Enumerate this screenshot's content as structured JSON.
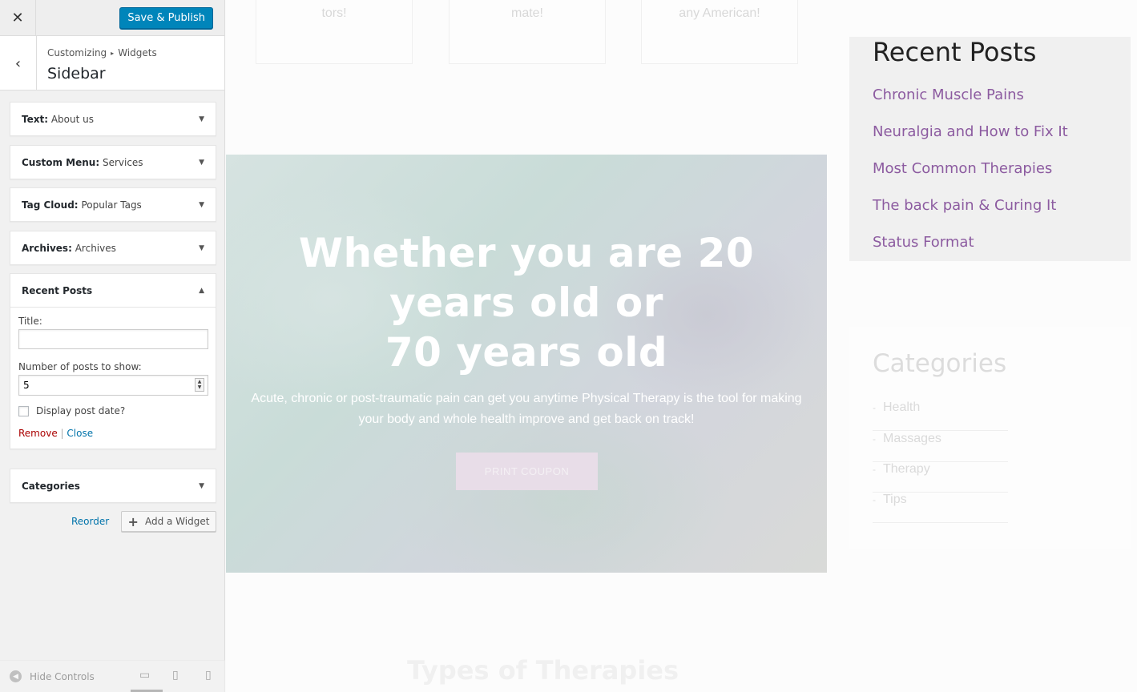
{
  "panel": {
    "close_symbol": "✕",
    "save_label": "Save & Publish",
    "back_symbol": "‹",
    "breadcrumb": {
      "root": "Customizing",
      "separator": "▸",
      "current": "Widgets"
    },
    "section_title": "Sidebar",
    "widgets": [
      {
        "type": "Text:",
        "name": "About us",
        "arrow": "▼"
      },
      {
        "type": "Custom Menu:",
        "name": "Services",
        "arrow": "▼"
      },
      {
        "type": "Tag Cloud:",
        "name": "Popular Tags",
        "arrow": "▼"
      },
      {
        "type": "Archives:",
        "name": "Archives",
        "arrow": "▼"
      },
      {
        "type": "Recent Posts",
        "name": "",
        "arrow": "▲"
      },
      {
        "type": "Categories",
        "name": "",
        "arrow": "▼"
      }
    ],
    "recent_form": {
      "title_label": "Title:",
      "title_value": "",
      "number_label": "Number of posts to show:",
      "number_value": "5",
      "date_label": "Display post date?",
      "date_checked": false,
      "remove_label": "Remove",
      "divider": "|",
      "close_label": "Close"
    },
    "reorder_label": "Reorder",
    "add_widget_label": "Add a Widget",
    "hide_controls_label": "Hide Controls"
  },
  "preview": {
    "top_cards": [
      "tors!",
      "mate!",
      "any American!"
    ],
    "hero": {
      "heading_lines": [
        "Whether you are 20",
        "years old or",
        "70 years old"
      ],
      "subtitle_lines": [
        "Acute, chronic or post-traumatic pain can get you anytime Physical Therapy is the tool for making",
        "your body and whole health improve and get back on track!"
      ],
      "button_label": "PRINT COUPON"
    },
    "recent_posts": {
      "title": "Recent Posts",
      "items": [
        "Chronic Muscle Pains",
        "Neuralgia and How to Fix It",
        "Most Common Therapies",
        "The back pain & Curing It",
        "Status Format"
      ],
      "link_color": "#8c5ba0"
    },
    "categories": {
      "title": "Categories",
      "dash": "-",
      "items": [
        "Health",
        "Massages",
        "Therapy",
        "Tips"
      ]
    },
    "section_title": "Types of Therapies"
  },
  "colors": {
    "primary_button": "#0085ba",
    "link": "#0073aa",
    "remove": "#aa0000"
  },
  "icons": {
    "close": "close-icon",
    "back": "back-chevron-icon",
    "plus": "plus-icon",
    "desktop": "desktop-icon",
    "tablet": "tablet-icon",
    "mobile": "mobile-icon"
  }
}
